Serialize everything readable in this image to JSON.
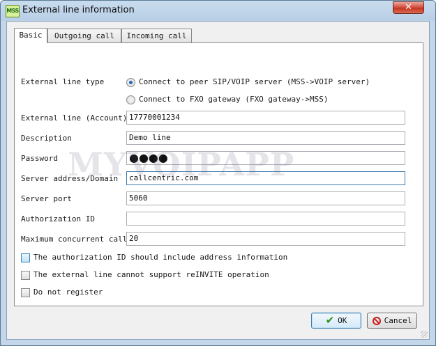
{
  "window": {
    "title": "External line information",
    "app_icon_text": "MSS",
    "close_symbol": "✕"
  },
  "tabs": [
    {
      "label": "Basic",
      "active": true
    },
    {
      "label": "Outgoing call",
      "active": false
    },
    {
      "label": "Incoming call",
      "active": false
    }
  ],
  "form": {
    "line_type_label": "External line type",
    "line_type_options": [
      {
        "label": "Connect to peer SIP/VOIP server (MSS->VOIP server)",
        "selected": true
      },
      {
        "label": "Connect to FXO gateway (FXO gateway->MSS)",
        "selected": false
      }
    ],
    "account_label": "External line (Account)",
    "account_value": "17770001234",
    "description_label": "Description",
    "description_value": "Demo line",
    "password_label": "Password",
    "password_value": "●●●●",
    "server_label": "Server address/Domain",
    "server_value": "callcentric.com",
    "port_label": "Server port",
    "port_value": "5060",
    "auth_label": "Authorization ID",
    "auth_value": "",
    "max_calls_label": "Maximum concurrent calls",
    "max_calls_value": "20"
  },
  "options": [
    {
      "label": "The authorization ID should include address information",
      "checked": false
    },
    {
      "label": "The external line cannot support reINVITE operation",
      "checked": false
    },
    {
      "label": "Do not register",
      "checked": false
    }
  ],
  "buttons": {
    "ok": "OK",
    "cancel": "Cancel"
  },
  "watermark": "MYVOIPAPP"
}
